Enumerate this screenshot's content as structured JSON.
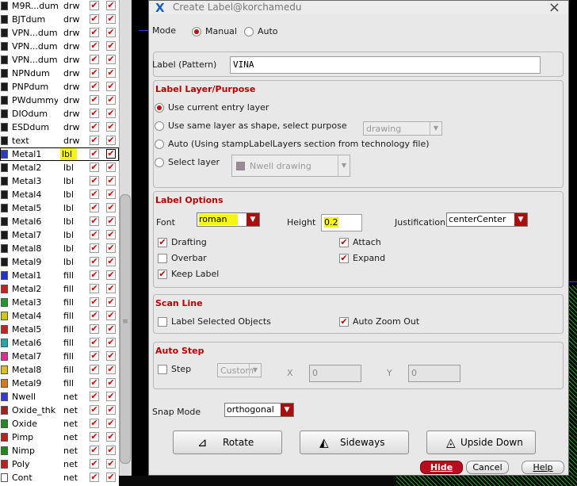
{
  "palette": {
    "rows": [
      {
        "name": "M9R...dum",
        "purpose": "drw",
        "c1": true,
        "c2": true,
        "color": "#1a1a1a"
      },
      {
        "name": "BJTdum",
        "purpose": "drw",
        "c1": true,
        "c2": true,
        "color": "#1a1a1a"
      },
      {
        "name": "VPN...dum",
        "purpose": "drw",
        "c1": true,
        "c2": true,
        "color": "#1a1a1a"
      },
      {
        "name": "VPN...dum",
        "purpose": "drw",
        "c1": true,
        "c2": true,
        "color": "#1a1a1a"
      },
      {
        "name": "VPN...dum",
        "purpose": "drw",
        "c1": true,
        "c2": true,
        "color": "#1a1a1a"
      },
      {
        "name": "NPNdum",
        "purpose": "drw",
        "c1": true,
        "c2": true,
        "color": "#1a1a1a"
      },
      {
        "name": "PNPdum",
        "purpose": "drw",
        "c1": true,
        "c2": true,
        "color": "#1a1a1a"
      },
      {
        "name": "PWdummy",
        "purpose": "drw",
        "c1": true,
        "c2": true,
        "color": "#1a1a1a"
      },
      {
        "name": "DIOdum",
        "purpose": "drw",
        "c1": true,
        "c2": true,
        "color": "#1a1a1a"
      },
      {
        "name": "ESDdum",
        "purpose": "drw",
        "c1": true,
        "c2": true,
        "color": "#1a1a1a"
      },
      {
        "name": "text",
        "purpose": "drw",
        "c1": true,
        "c2": true,
        "color": "#1a1a1a"
      },
      {
        "name": "Metal1",
        "purpose": "lbl",
        "c1": true,
        "c2": true,
        "color": "#2a3fbf",
        "selected": true
      },
      {
        "name": "Metal2",
        "purpose": "lbl",
        "c1": true,
        "c2": true,
        "color": "#1a1a1a"
      },
      {
        "name": "Metal3",
        "purpose": "lbl",
        "c1": true,
        "c2": true,
        "color": "#1a1a1a"
      },
      {
        "name": "Metal4",
        "purpose": "lbl",
        "c1": true,
        "c2": true,
        "color": "#1a1a1a"
      },
      {
        "name": "Metal5",
        "purpose": "lbl",
        "c1": true,
        "c2": true,
        "color": "#1a1a1a"
      },
      {
        "name": "Metal6",
        "purpose": "lbl",
        "c1": true,
        "c2": true,
        "color": "#1a1a1a"
      },
      {
        "name": "Metal7",
        "purpose": "lbl",
        "c1": true,
        "c2": true,
        "color": "#1a1a1a"
      },
      {
        "name": "Metal8",
        "purpose": "lbl",
        "c1": true,
        "c2": true,
        "color": "#1a1a1a"
      },
      {
        "name": "Metal9",
        "purpose": "lbl",
        "c1": true,
        "c2": true,
        "color": "#1a1a1a"
      },
      {
        "name": "Metal1",
        "purpose": "fill",
        "c1": true,
        "c2": true,
        "color": "#2233cc"
      },
      {
        "name": "Metal2",
        "purpose": "fill",
        "c1": true,
        "c2": true,
        "color": "#cc1f1f"
      },
      {
        "name": "Metal3",
        "purpose": "fill",
        "c1": true,
        "c2": true,
        "color": "#1f9a2a"
      },
      {
        "name": "Metal4",
        "purpose": "fill",
        "c1": true,
        "c2": true,
        "color": "#c9c91a"
      },
      {
        "name": "Metal5",
        "purpose": "fill",
        "c1": true,
        "c2": true,
        "color": "#cc1f1f"
      },
      {
        "name": "Metal6",
        "purpose": "fill",
        "c1": true,
        "c2": true,
        "color": "#1fa8b0"
      },
      {
        "name": "Metal7",
        "purpose": "fill",
        "c1": true,
        "c2": true,
        "color": "#d92f8e"
      },
      {
        "name": "Metal8",
        "purpose": "fill",
        "c1": true,
        "c2": true,
        "color": "#d9c21a"
      },
      {
        "name": "Metal9",
        "purpose": "fill",
        "c1": true,
        "c2": true,
        "color": "#d97a1a"
      },
      {
        "name": "Nwell",
        "purpose": "net",
        "c1": true,
        "c2": true,
        "color": "#3a3ad6"
      },
      {
        "name": "Oxide_thk",
        "purpose": "net",
        "c1": true,
        "c2": true,
        "color": "#a51f1f"
      },
      {
        "name": "Oxide",
        "purpose": "net",
        "c1": true,
        "c2": true,
        "color": "#1f8a1f"
      },
      {
        "name": "Pimp",
        "purpose": "net",
        "c1": true,
        "c2": true,
        "color": "#c01f1f"
      },
      {
        "name": "Nimp",
        "purpose": "net",
        "c1": true,
        "c2": true,
        "color": "#1f8a1f"
      },
      {
        "name": "Poly",
        "purpose": "net",
        "c1": true,
        "c2": true,
        "color": "#c01f1f"
      },
      {
        "name": "Cont",
        "purpose": "net",
        "c1": true,
        "c2": true,
        "color": "#ffffff"
      }
    ]
  },
  "dialog": {
    "title": "Create Label@korchamedu",
    "mode": {
      "label": "Mode",
      "options": [
        "Manual",
        "Auto"
      ],
      "selected": "Manual"
    },
    "label_pattern": {
      "label": "Label (Pattern)",
      "value": "VINA"
    },
    "layer_purpose": {
      "title": "Label Layer/Purpose",
      "options": [
        "Use current entry layer",
        "Use same layer as shape, select purpose",
        "Auto (Using stampLabelLayers section from technology file)",
        "Select layer"
      ],
      "selected": 0,
      "purpose_value": "drawing",
      "layer_value": "Nwell drawing"
    },
    "label_options": {
      "title": "Label Options",
      "font_label": "Font",
      "font_value": "roman",
      "height_label": "Height",
      "height_value": "0.2",
      "justification_label": "Justification",
      "justification_value": "centerCenter",
      "drafting": "Drafting",
      "drafting_checked": true,
      "attach": "Attach",
      "attach_checked": true,
      "overbar": "Overbar",
      "overbar_checked": false,
      "expand": "Expand",
      "expand_checked": true,
      "keep_label": "Keep Label",
      "keep_label_checked": true
    },
    "scan_line": {
      "title": "Scan Line",
      "label_selected": "Label Selected Objects",
      "label_selected_checked": false,
      "auto_zoom": "Auto Zoom Out",
      "auto_zoom_checked": true
    },
    "auto_step": {
      "title": "Auto Step",
      "step": "Step",
      "step_checked": false,
      "step_mode": "Custom",
      "x_label": "X",
      "x_value": "0",
      "y_label": "Y",
      "y_value": "0"
    },
    "snap_mode": {
      "label": "Snap Mode",
      "value": "orthogonal"
    },
    "buttons": {
      "rotate": "Rotate",
      "sideways": "Sideways",
      "upside_down": "Upside Down",
      "hide": "Hide",
      "cancel": "Cancel",
      "help": "Help"
    }
  }
}
